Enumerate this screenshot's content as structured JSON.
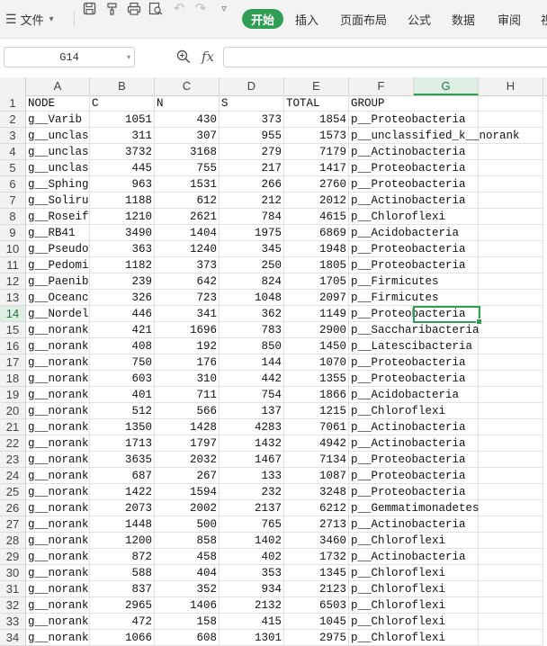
{
  "ribbon": {
    "file_menu": "文件",
    "tabs": [
      "开始",
      "插入",
      "页面布局",
      "公式",
      "数据",
      "审阅",
      "视"
    ],
    "active_tab": "开始",
    "icons": [
      "save-icon",
      "format-painter-icon",
      "print-icon",
      "print-preview-icon",
      "undo-icon",
      "redo-icon",
      "more-icon"
    ]
  },
  "formula_bar": {
    "name_box": "G14",
    "fx": "fx",
    "formula": ""
  },
  "grid": {
    "columns": [
      "A",
      "B",
      "C",
      "D",
      "E",
      "F",
      "G",
      "H"
    ],
    "selected_column": "G",
    "selected_row": 14,
    "selected_cell": "G14",
    "rows": [
      {
        "n": 1,
        "cells": [
          "NODE",
          "C",
          "N",
          "S",
          "TOTAL",
          "GROUP"
        ]
      },
      {
        "n": 2,
        "cells": [
          "g__Varib",
          "1051",
          "430",
          "373",
          "1854",
          "p__Proteobacteria"
        ]
      },
      {
        "n": 3,
        "cells": [
          "g__unclas",
          "311",
          "307",
          "955",
          "1573",
          "p__unclassified_k__norank"
        ]
      },
      {
        "n": 4,
        "cells": [
          "g__unclas",
          "3732",
          "3168",
          "279",
          "7179",
          "p__Actinobacteria"
        ]
      },
      {
        "n": 5,
        "cells": [
          "g__unclas",
          "445",
          "755",
          "217",
          "1417",
          "p__Proteobacteria"
        ]
      },
      {
        "n": 6,
        "cells": [
          "g__Sphing",
          "963",
          "1531",
          "266",
          "2760",
          "p__Proteobacteria"
        ]
      },
      {
        "n": 7,
        "cells": [
          "g__Soliru",
          "1188",
          "612",
          "212",
          "2012",
          "p__Actinobacteria"
        ]
      },
      {
        "n": 8,
        "cells": [
          "g__Roseif",
          "1210",
          "2621",
          "784",
          "4615",
          "p__Chloroflexi"
        ]
      },
      {
        "n": 9,
        "cells": [
          "g__RB41",
          "3490",
          "1404",
          "1975",
          "6869",
          "p__Acidobacteria"
        ]
      },
      {
        "n": 10,
        "cells": [
          "g__Pseudo",
          "363",
          "1240",
          "345",
          "1948",
          "p__Proteobacteria"
        ]
      },
      {
        "n": 11,
        "cells": [
          "g__Pedomi",
          "1182",
          "373",
          "250",
          "1805",
          "p__Proteobacteria"
        ]
      },
      {
        "n": 12,
        "cells": [
          "g__Paenib",
          "239",
          "642",
          "824",
          "1705",
          "p__Firmicutes"
        ]
      },
      {
        "n": 13,
        "cells": [
          "g__Oceanc",
          "326",
          "723",
          "1048",
          "2097",
          "p__Firmicutes"
        ]
      },
      {
        "n": 14,
        "cells": [
          "g__Nordel",
          "446",
          "341",
          "362",
          "1149",
          "p__Proteobacteria"
        ]
      },
      {
        "n": 15,
        "cells": [
          "g__norank",
          "421",
          "1696",
          "783",
          "2900",
          "p__Saccharibacteria"
        ]
      },
      {
        "n": 16,
        "cells": [
          "g__norank",
          "408",
          "192",
          "850",
          "1450",
          "p__Latescibacteria"
        ]
      },
      {
        "n": 17,
        "cells": [
          "g__norank",
          "750",
          "176",
          "144",
          "1070",
          "p__Proteobacteria"
        ]
      },
      {
        "n": 18,
        "cells": [
          "g__norank",
          "603",
          "310",
          "442",
          "1355",
          "p__Proteobacteria"
        ]
      },
      {
        "n": 19,
        "cells": [
          "g__norank",
          "401",
          "711",
          "754",
          "1866",
          "p__Acidobacteria"
        ]
      },
      {
        "n": 20,
        "cells": [
          "g__norank",
          "512",
          "566",
          "137",
          "1215",
          "p__Chloroflexi"
        ]
      },
      {
        "n": 21,
        "cells": [
          "g__norank",
          "1350",
          "1428",
          "4283",
          "7061",
          "p__Actinobacteria"
        ]
      },
      {
        "n": 22,
        "cells": [
          "g__norank",
          "1713",
          "1797",
          "1432",
          "4942",
          "p__Actinobacteria"
        ]
      },
      {
        "n": 23,
        "cells": [
          "g__norank",
          "3635",
          "2032",
          "1467",
          "7134",
          "p__Proteobacteria"
        ]
      },
      {
        "n": 24,
        "cells": [
          "g__norank",
          "687",
          "267",
          "133",
          "1087",
          "p__Proteobacteria"
        ]
      },
      {
        "n": 25,
        "cells": [
          "g__norank",
          "1422",
          "1594",
          "232",
          "3248",
          "p__Proteobacteria"
        ]
      },
      {
        "n": 26,
        "cells": [
          "g__norank",
          "2073",
          "2002",
          "2137",
          "6212",
          "p__Gemmatimonadetes"
        ]
      },
      {
        "n": 27,
        "cells": [
          "g__norank",
          "1448",
          "500",
          "765",
          "2713",
          "p__Actinobacteria"
        ]
      },
      {
        "n": 28,
        "cells": [
          "g__norank",
          "1200",
          "858",
          "1402",
          "3460",
          "p__Chloroflexi"
        ]
      },
      {
        "n": 29,
        "cells": [
          "g__norank",
          "872",
          "458",
          "402",
          "1732",
          "p__Actinobacteria"
        ]
      },
      {
        "n": 30,
        "cells": [
          "g__norank",
          "588",
          "404",
          "353",
          "1345",
          "p__Chloroflexi"
        ]
      },
      {
        "n": 31,
        "cells": [
          "g__norank",
          "837",
          "352",
          "934",
          "2123",
          "p__Chloroflexi"
        ]
      },
      {
        "n": 32,
        "cells": [
          "g__norank",
          "2965",
          "1406",
          "2132",
          "6503",
          "p__Chloroflexi"
        ]
      },
      {
        "n": 33,
        "cells": [
          "g__norank",
          "472",
          "158",
          "415",
          "1045",
          "p__Chloroflexi"
        ]
      },
      {
        "n": 34,
        "cells": [
          "g__norank",
          "1066",
          "608",
          "1301",
          "2975",
          "p__Chloroflexi"
        ]
      }
    ]
  }
}
